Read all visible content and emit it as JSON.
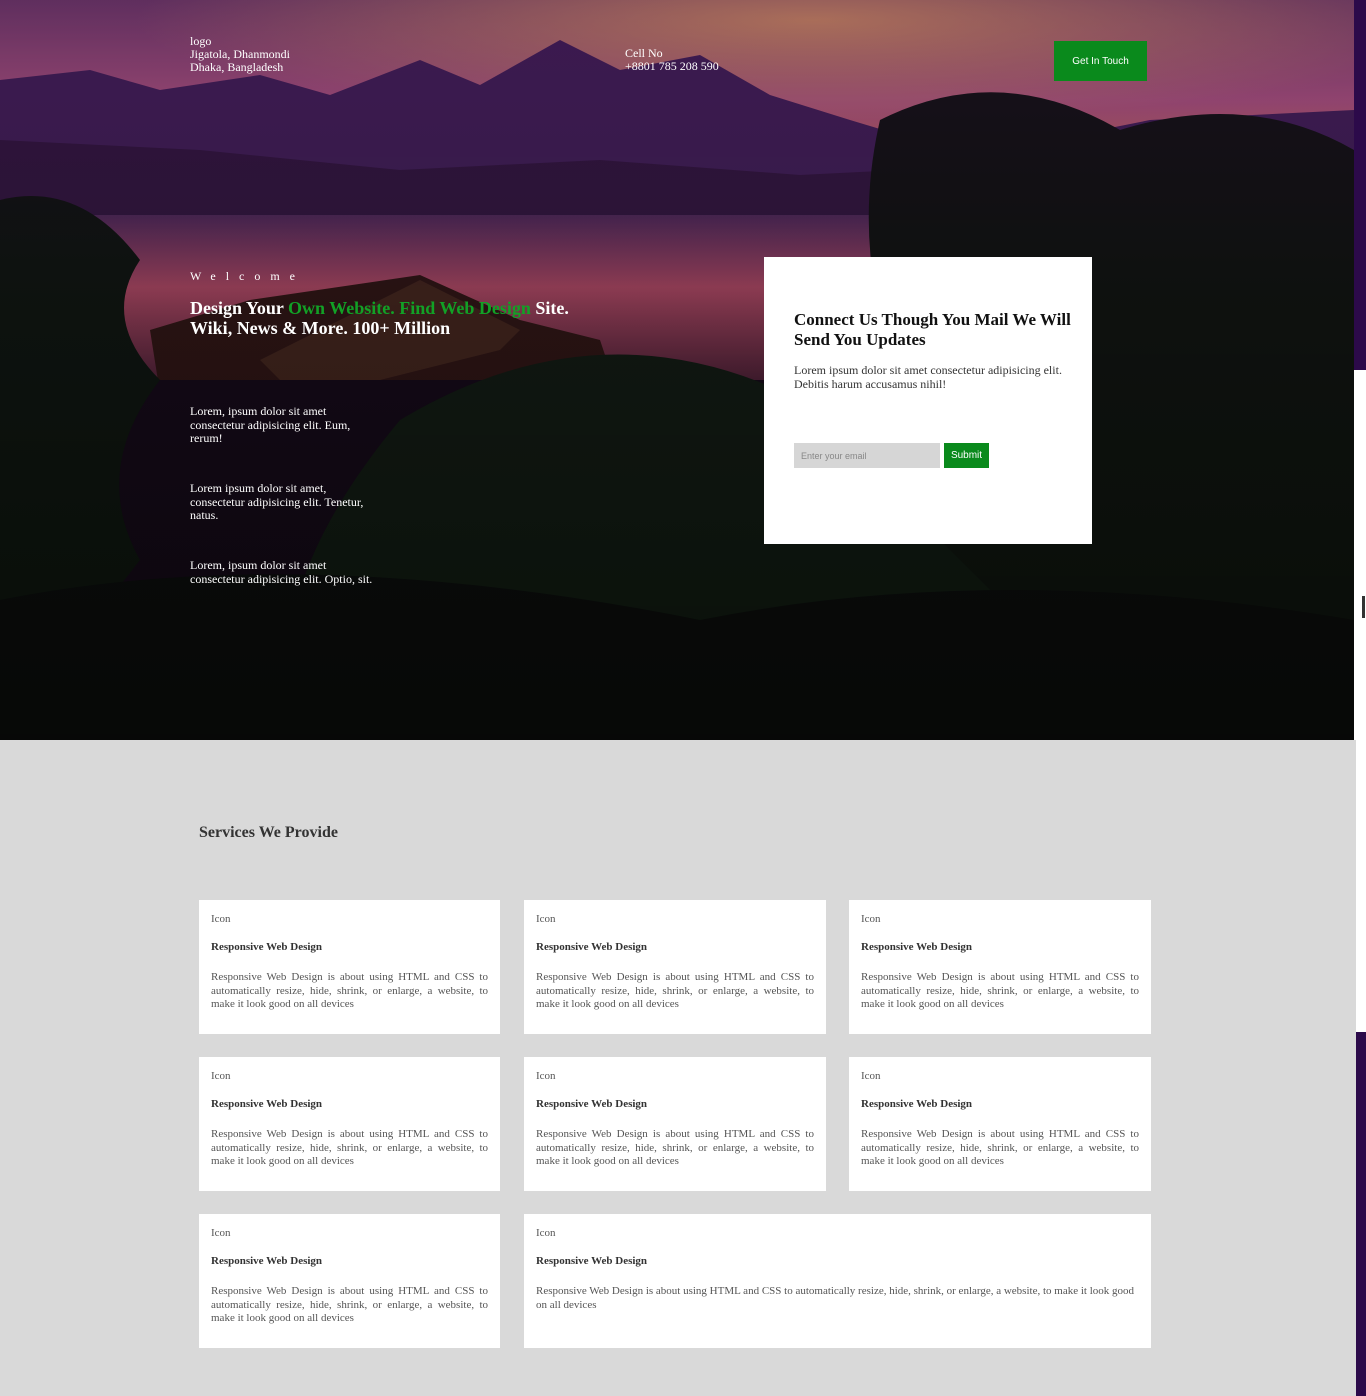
{
  "header": {
    "logo": "logo",
    "address_line1": "Jigatola, Dhanmondi",
    "address_line2": "Dhaka, Bangladesh",
    "cell_label": "Cell No",
    "cell_number": "+8801 785 208 590",
    "cta_label": "Get In Touch"
  },
  "hero": {
    "welcome": "Welcome",
    "headline_part1": "Design Your ",
    "headline_highlight": "Own Website. Find Web Design",
    "headline_part2": " Site.",
    "headline_line2": "Wiki, News & More. 100+ Million",
    "paragraphs": [
      "Lorem, ipsum dolor sit amet consectetur adipisicing elit. Eum, rerum!",
      "Lorem ipsum dolor sit amet, consectetur adipisicing elit. Tenetur, natus.",
      "Lorem, ipsum dolor sit amet consectetur adipisicing elit. Optio, sit."
    ]
  },
  "subscribe": {
    "title": "Connect Us Though You Mail We Will Send You Updates",
    "text": "Lorem ipsum dolor sit amet consectetur adipisicing elit. Debitis harum accusamus nihil!",
    "email_placeholder": "Enter your email",
    "submit_label": "Submit"
  },
  "services": {
    "title": "Services We Provide",
    "items": [
      {
        "icon": "Icon",
        "title": "Responsive Web Design",
        "desc": "Responsive Web Design is about using HTML and CSS to automatically resize, hide, shrink, or enlarge, a website, to make it look good on all devices"
      },
      {
        "icon": "Icon",
        "title": "Responsive Web Design",
        "desc": "Responsive Web Design is about using HTML and CSS to automatically resize, hide, shrink, or enlarge, a website, to make it look good on all devices"
      },
      {
        "icon": "Icon",
        "title": "Responsive Web Design",
        "desc": "Responsive Web Design is about using HTML and CSS to automatically resize, hide, shrink, or enlarge, a website, to make it look good on all devices"
      },
      {
        "icon": "Icon",
        "title": "Responsive Web Design",
        "desc": "Responsive Web Design is about using HTML and CSS to automatically resize, hide, shrink, or enlarge, a website, to make it look good on all devices"
      },
      {
        "icon": "Icon",
        "title": "Responsive Web Design",
        "desc": "Responsive Web Design is about using HTML and CSS to automatically resize, hide, shrink, or enlarge, a website, to make it look good on all devices"
      },
      {
        "icon": "Icon",
        "title": "Responsive Web Design",
        "desc": "Responsive Web Design is about using HTML and CSS to automatically resize, hide, shrink, or enlarge, a website, to make it look good on all devices"
      },
      {
        "icon": "Icon",
        "title": "Responsive Web Design",
        "desc": "Responsive Web Design is about using HTML and CSS to automatically resize, hide, shrink, or enlarge, a website, to make it look good on all devices"
      },
      {
        "icon": "Icon",
        "title": "Responsive Web Design",
        "desc": "Responsive Web Design is about using HTML and CSS to automatically resize, hide, shrink, or enlarge, a website, to make it look good on all devices"
      }
    ]
  },
  "colors": {
    "accent_green": "#0a8a1c",
    "highlight_green": "#12a126",
    "services_bg": "#d9d9d9"
  }
}
